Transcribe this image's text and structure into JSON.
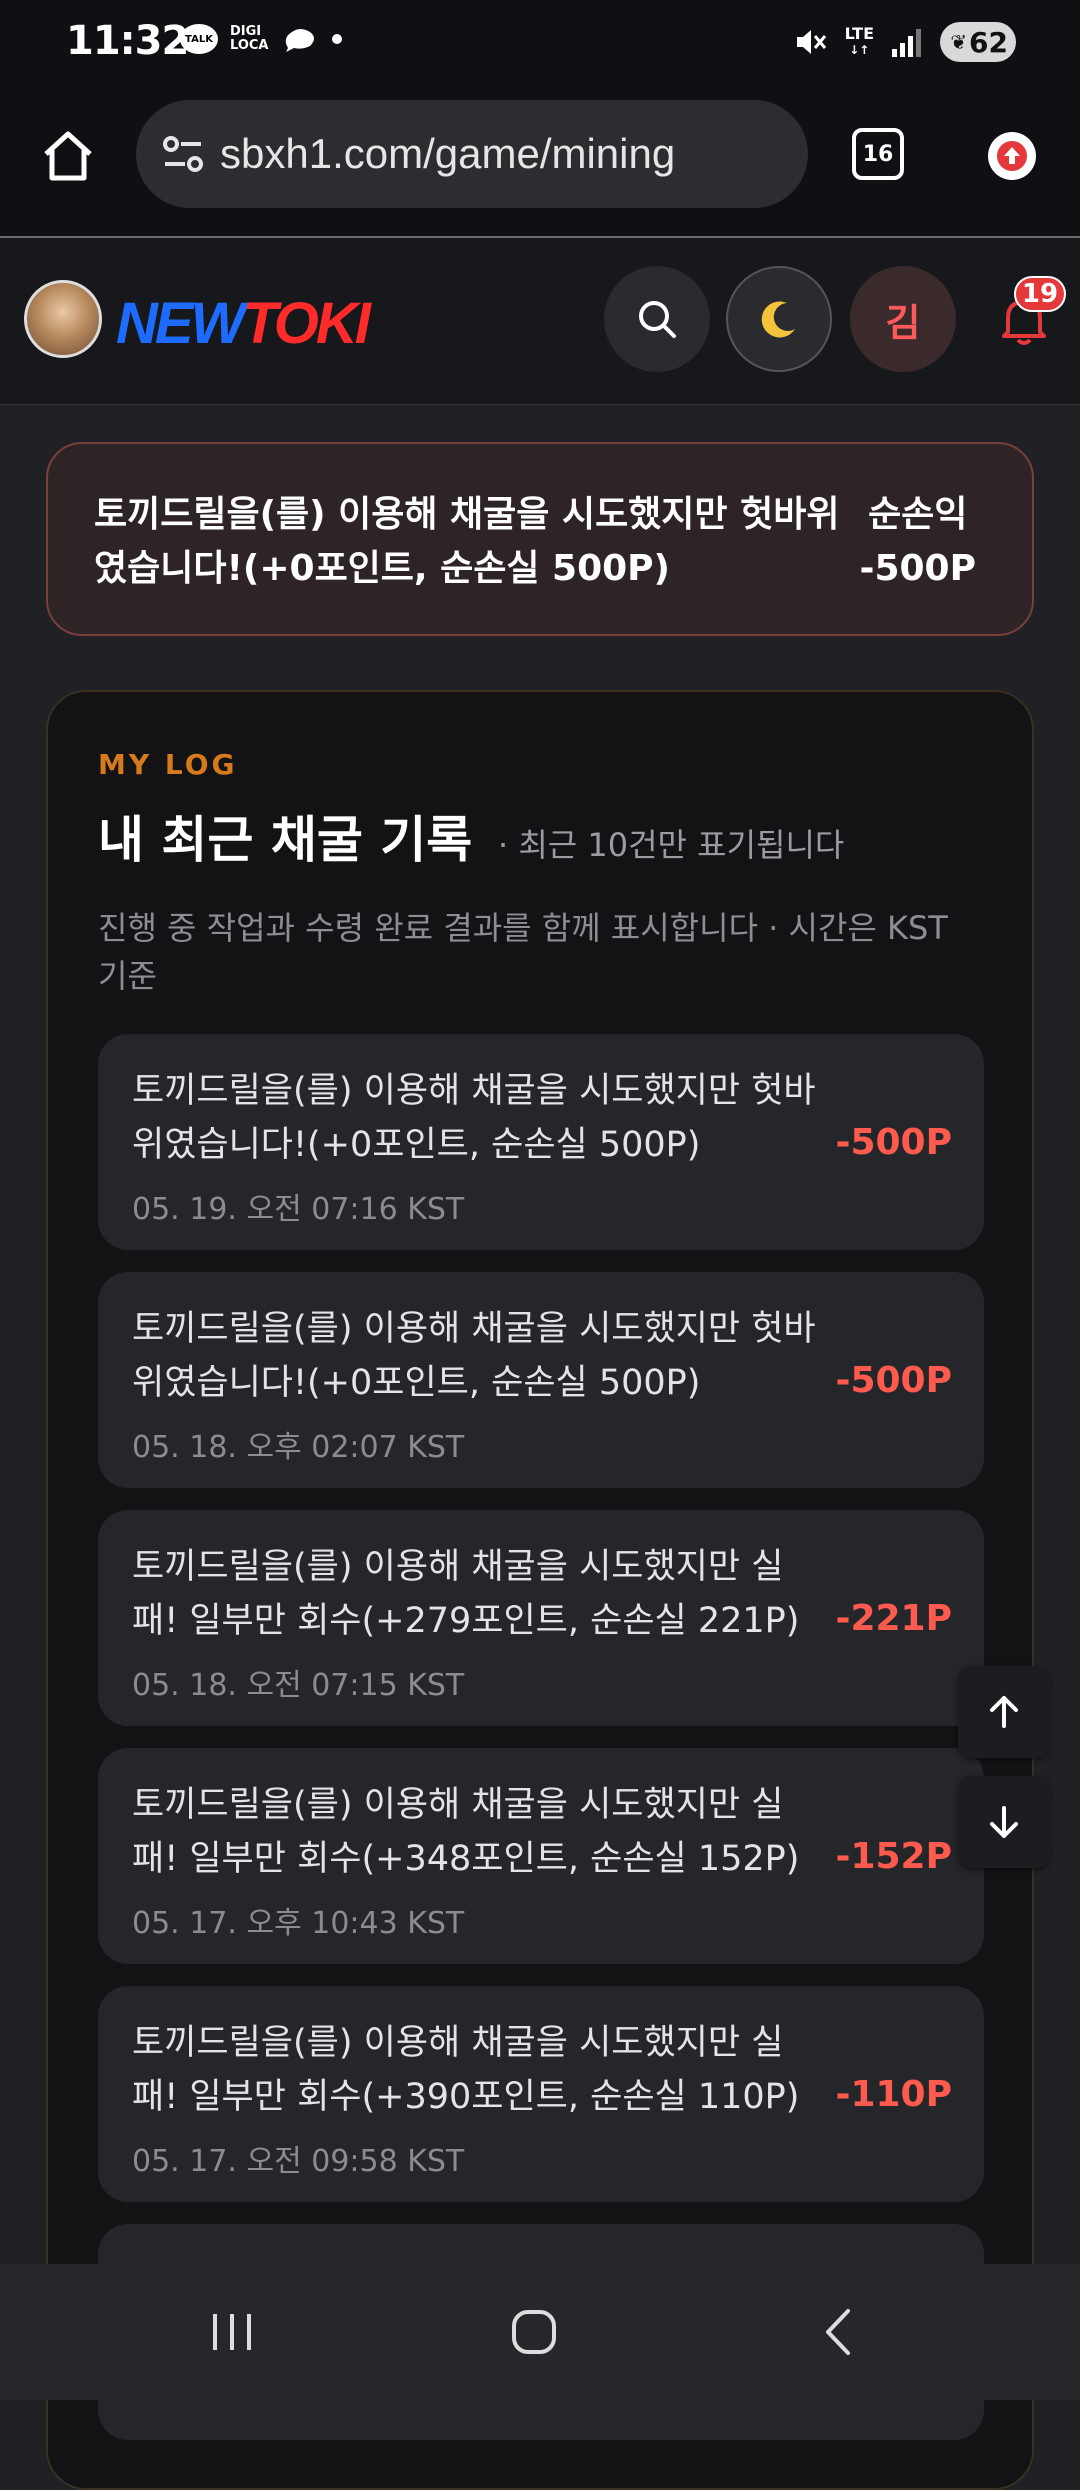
{
  "status": {
    "time": "11:32",
    "talk_label": "TALK",
    "digi_line1": "DIGI",
    "digi_line2": "LOCA",
    "network": "LTE",
    "battery": "62"
  },
  "browser": {
    "url": "sbxh1.com/game/mining",
    "tab_count": "16"
  },
  "site": {
    "logo_part1": "NEW",
    "logo_part2": "TOKI",
    "user_initial": "김",
    "notification_count": "19"
  },
  "notice": {
    "message": "토끼드릴을(를) 이용해 채굴을 시도했지만 헛바위였습니다!(+0포인트, 순손실 500P)",
    "net_label": "순손익",
    "net_value": "-500P"
  },
  "log": {
    "eyebrow": "MY LOG",
    "title": "내 최근 채굴 기록",
    "hint": "· 최근 10건만 표기됩니다",
    "description": "진행 중 작업과 수령 완료 결과를 함께 표시합니다 · 시간은 KST 기준",
    "entries": [
      {
        "message": "토끼드릴을(를) 이용해 채굴을 시도했지만 헛바위였습니다!(+0포인트, 순손실 500P)",
        "time": "05. 19. 오전 07:16 KST",
        "amount": "-500P"
      },
      {
        "message": "토끼드릴을(를) 이용해 채굴을 시도했지만 헛바위였습니다!(+0포인트, 순손실 500P)",
        "time": "05. 18. 오후 02:07 KST",
        "amount": "-500P"
      },
      {
        "message": "토끼드릴을(를) 이용해 채굴을 시도했지만 실패! 일부만 회수(+279포인트, 순손실 221P)",
        "time": "05. 18. 오전 07:15 KST",
        "amount": "-221P"
      },
      {
        "message": "토끼드릴을(를) 이용해 채굴을 시도했지만 실패! 일부만 회수(+348포인트, 순손실 152P)",
        "time": "05. 17. 오후 10:43 KST",
        "amount": "-152P"
      },
      {
        "message": "토끼드릴을(를) 이용해 채굴을 시도했지만 실패! 일부만 회수(+390포인트, 순손실 110P)",
        "time": "05. 17. 오전 09:58 KST",
        "amount": "-110P"
      }
    ]
  },
  "colors": {
    "accent_orange": "#d67a1c",
    "loss_red": "#ff5a4e",
    "background": "#202124"
  }
}
